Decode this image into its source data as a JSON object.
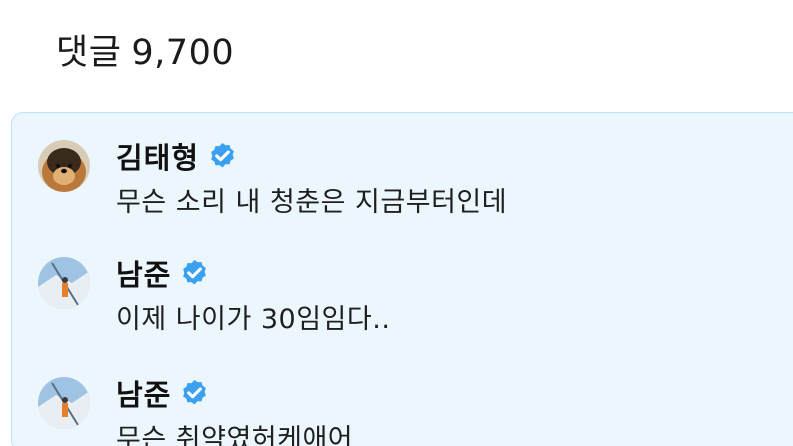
{
  "header": {
    "label": "댓글",
    "count": "9,700"
  },
  "comments": [
    {
      "author": "김태형",
      "verified": true,
      "avatar_icon": "dog-avatar-icon",
      "text": "무슨 소리 내 청춘은 지금부터인데"
    },
    {
      "author": "남준",
      "verified": true,
      "avatar_icon": "person-snow-avatar-icon",
      "text": "이제 나이가 30임임다.."
    },
    {
      "author": "남준",
      "verified": true,
      "avatar_icon": "person-snow-avatar-icon",
      "text": "무슨 취약였허케애어"
    }
  ],
  "colors": {
    "panel_bg": "#ecf7fd",
    "panel_border": "#bfe3f4",
    "verified_badge": "#3aa0f0"
  }
}
